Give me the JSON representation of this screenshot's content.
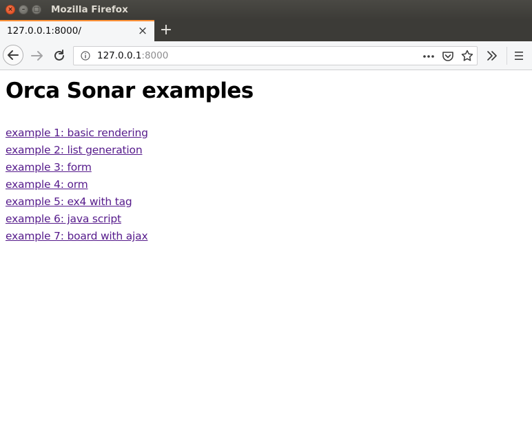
{
  "window": {
    "title": "Mozilla Firefox",
    "controls": {
      "close": "×",
      "minimize": "–",
      "maximize": "□"
    }
  },
  "tab": {
    "label": "127.0.0.1:8000/",
    "close": "×",
    "new_tab": "+"
  },
  "navbar": {
    "url_host": "127.0.0.1",
    "url_port": ":8000",
    "icons": [
      "back-arrow-icon",
      "forward-arrow-icon",
      "reload-icon",
      "info-icon",
      "page-actions-icon",
      "pocket-icon",
      "bookmark-star-icon",
      "overflow-chevron-icon",
      "menu-hamburger-icon"
    ]
  },
  "page": {
    "title": "Orca Sonar examples",
    "links": [
      "example 1: basic rendering",
      "example 2: list generation",
      "example 3: form",
      "example 4: orm",
      "example 5: ex4 with tag",
      "example 6: java script",
      "example 7: board with ajax"
    ]
  },
  "colors": {
    "titlebar": "#3c3b37",
    "tab_accent": "#ff9237",
    "visited_link": "#551a8b",
    "toolbar": "#f5f6f7"
  }
}
